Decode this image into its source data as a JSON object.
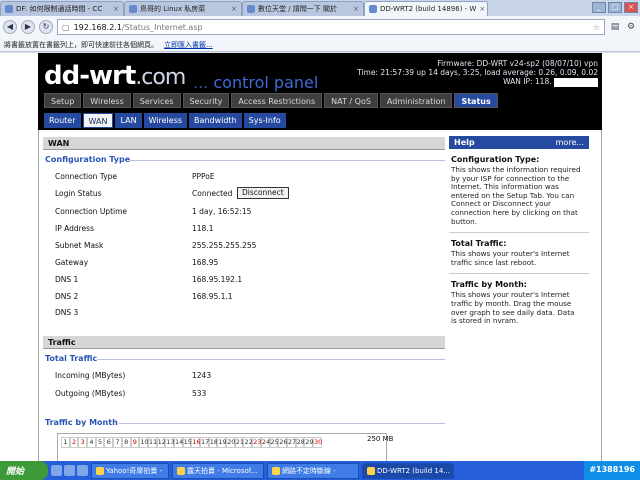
{
  "browser": {
    "tabs": [
      {
        "label": "DF: 如何限制通話時間 - CC",
        "active": false
      },
      {
        "label": "鳥哥的 Linux 私房菜",
        "active": false
      },
      {
        "label": "數位天堂 / 請問一下 關於",
        "active": false
      },
      {
        "label": "DD-WRT2 (build 14896) - W",
        "active": true
      }
    ],
    "window_buttons": [
      "_",
      "□",
      "×"
    ],
    "url_host": "192.168.2.1",
    "url_path": "/Status_Internet.asp",
    "bookmark_hint": "將書籤放置在書籤列上，即可快速前往各個網頁。",
    "bookmark_link": "立即匯入書籤..."
  },
  "router": {
    "logo_main": "dd-wrt",
    "logo_suffix": ".com",
    "cpanel_prefix": "...",
    "cpanel_text": "control panel",
    "fw_line1": "Firmware: DD-WRT v24-sp2 (08/07/10) vpn",
    "fw_line2": "Time: 21:57:39 up 14 days, 3:25, load average: 0.26, 0.09, 0.02",
    "fw_line3": "WAN IP: 118.",
    "main_tabs": [
      {
        "label": "Setup",
        "active": false
      },
      {
        "label": "Wireless",
        "active": false
      },
      {
        "label": "Services",
        "active": false
      },
      {
        "label": "Security",
        "active": false
      },
      {
        "label": "Access Restrictions",
        "active": false
      },
      {
        "label": "NAT / QoS",
        "active": false
      },
      {
        "label": "Administration",
        "active": false
      },
      {
        "label": "Status",
        "active": true
      }
    ],
    "sub_tabs": [
      {
        "label": "Router",
        "active": false
      },
      {
        "label": "WAN",
        "active": true
      },
      {
        "label": "LAN",
        "active": false
      },
      {
        "label": "Wireless",
        "active": false
      },
      {
        "label": "Bandwidth",
        "active": false
      },
      {
        "label": "Sys-Info",
        "active": false
      }
    ]
  },
  "wan": {
    "section_title": "WAN",
    "legend": "Configuration Type",
    "rows": [
      {
        "label": "Connection Type",
        "value": "PPPoE"
      },
      {
        "label": "Login Status",
        "value": "Connected"
      },
      {
        "label": "Connection Uptime",
        "value": "1 day, 16:52:15"
      },
      {
        "label": "IP Address",
        "value": "118.1"
      },
      {
        "label": "Subnet Mask",
        "value": "255.255.255.255"
      },
      {
        "label": "Gateway",
        "value": "168.95"
      },
      {
        "label": "DNS 1",
        "value": "168.95.192.1"
      },
      {
        "label": "DNS 2",
        "value": "168.95.1.1"
      },
      {
        "label": "DNS 3",
        "value": ""
      }
    ],
    "disconnect_label": "Disconnect"
  },
  "traffic": {
    "section_title": "Traffic",
    "legend": "Total Traffic",
    "incoming_label": "Incoming (MBytes)",
    "incoming_value": "1243",
    "outgoing_label": "Outgoing (MBytes)",
    "outgoing_value": "533",
    "month_legend": "Traffic by Month",
    "days": [
      "1",
      "2",
      "3",
      "4",
      "5",
      "6",
      "7",
      "8",
      "9",
      "10",
      "11",
      "12",
      "13",
      "14",
      "15",
      "16",
      "17",
      "18",
      "19",
      "20",
      "21",
      "22",
      "23",
      "24",
      "25",
      "26",
      "27",
      "28",
      "29",
      "30"
    ],
    "red_days": [
      "2",
      "3",
      "9",
      "16",
      "23",
      "30"
    ],
    "scale_label": "250 MB"
  },
  "help": {
    "title": "Help",
    "more": "more...",
    "items": [
      {
        "title": "Configuration Type:",
        "text": "This shows the information required by your ISP for connection to the Internet. This information was entered on the Setup Tab. You can Connect or Disconnect your connection here by clicking on that button."
      },
      {
        "title": "Total Traffic:",
        "text": "This shows your router's Internet traffic since last reboot."
      },
      {
        "title": "Traffic by Month:",
        "text": "This shows your router's Internet traffic by month. Drag the mouse over graph to see daily data. Data is stored in nvram."
      }
    ]
  },
  "taskbar": {
    "start_label": "開始",
    "tasks": [
      {
        "label": "Yahoo!奇摩拍賣 -",
        "active": false
      },
      {
        "label": "露天拍賣 - Microsof...",
        "active": false
      },
      {
        "label": "網路不定時斷線 -",
        "active": false
      },
      {
        "label": "DD-WRT2 (build 14...",
        "active": true
      }
    ],
    "tray_text": "#1388196"
  }
}
